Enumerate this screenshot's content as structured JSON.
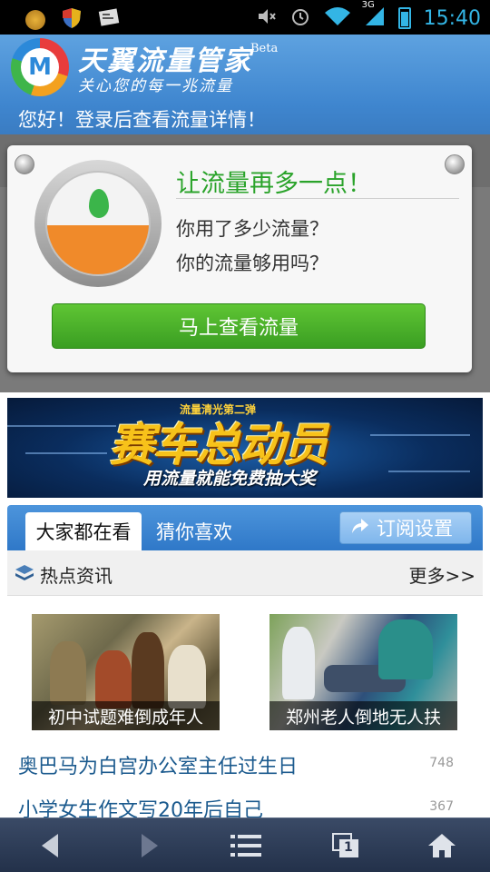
{
  "status_bar": {
    "time": "15:40",
    "network": "3G",
    "icons": [
      "coin-icon",
      "shield-icon",
      "card-icon",
      "mute-icon",
      "alarm-icon",
      "wifi-icon",
      "signal-icon",
      "battery-icon"
    ]
  },
  "app": {
    "title": "天翼流量管家",
    "beta": "Beta",
    "slogan": "关心您的每一兆流量",
    "login_tip": "您好！登录后查看流量详情！",
    "brand_color": "#3f86cf"
  },
  "popup": {
    "title": "让流量再多一点！",
    "line1": "你用了多少流量？",
    "line2": "你的流量够用吗？",
    "button": "马上查看流量",
    "title_color": "#2aa32a",
    "gauge_fill_fraction": 0.48
  },
  "banner": {
    "top_text": "流量清光第二弹",
    "main_text": "赛车总动员",
    "sub_text": "用流量就能免费抽大奖"
  },
  "tabs": {
    "active": "大家都在看",
    "other": "猜你喜欢",
    "subscribe": "订阅设置"
  },
  "hot": {
    "title": "热点资讯",
    "more": "更多>>"
  },
  "featured": [
    {
      "caption": "初中试题难倒成年人"
    },
    {
      "caption": "郑州老人倒地无人扶"
    }
  ],
  "news": [
    {
      "title": "奥巴马为白宫办公室主任过生日",
      "count": "748"
    },
    {
      "title": "小学女生作文写20年后自己",
      "count": "367"
    }
  ],
  "navbar": {
    "buttons": [
      "back-icon",
      "forward-icon",
      "menu-icon",
      "windows-icon",
      "home-icon"
    ],
    "window_count": "1"
  }
}
